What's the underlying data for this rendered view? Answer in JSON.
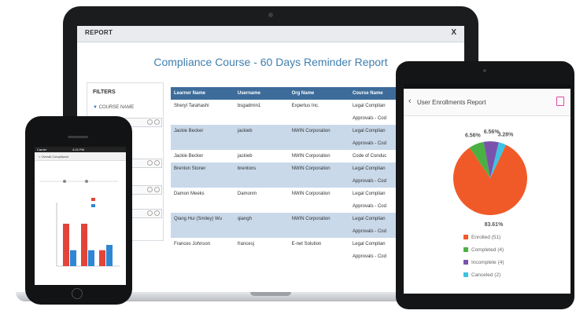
{
  "report": {
    "window_title": "REPORT",
    "close_label": "X",
    "title": "Compliance Course - 60 Days Reminder Report",
    "filters_title": "FILTERS",
    "filter_course_label": "COURSE NAME",
    "columns": [
      "Learner Name",
      "Username",
      "Org Name",
      "Course Name"
    ],
    "rows": [
      [
        "Sheryl Tarahashi",
        "bsgadmin1",
        "Expertus Inc.",
        "Legal Complian"
      ],
      [
        "",
        "",
        "",
        "Approvals - Cod"
      ],
      [
        "Jackie Becker",
        "jackieb",
        "NWIN Corporation",
        "Legal Complian"
      ],
      [
        "",
        "",
        "",
        "Approvals - Cod"
      ],
      [
        "Jackie Becker",
        "jackieb",
        "NWIN Corporation",
        "Code of Conduc"
      ],
      [
        "Brenton Stoner",
        "brentons",
        "NWIN Corporation",
        "Legal Complian"
      ],
      [
        "",
        "",
        "",
        "Approvals - Cod"
      ],
      [
        "Damon Meeks",
        "Damonm",
        "NWIN Corporation",
        "Legal Complian"
      ],
      [
        "",
        "",
        "",
        "Approvals - Cod"
      ],
      [
        "Qiang Hui (Smiley) Wu",
        "qiangh",
        "NWIN Corporation",
        "Legal Complian"
      ],
      [
        "",
        "",
        "",
        "Approvals - Cod"
      ],
      [
        "Frances Johnson",
        "francesj",
        "E-net Solution",
        "Legal Complian"
      ],
      [
        "",
        "",
        "",
        "Approvals - Cod"
      ]
    ]
  },
  "phone": {
    "status_carrier": "Carrier",
    "status_time": "4:24 PM",
    "nav_title": "< Overall Compliance",
    "chart_data": {
      "type": "bar",
      "categories": [
        "",
        "",
        ""
      ],
      "series": [
        {
          "name": "",
          "values": [
            4,
            4,
            1.5
          ],
          "color": "#e2443a"
        },
        {
          "name": "",
          "values": [
            1.5,
            1.5,
            2
          ],
          "color": "#2f86d3"
        }
      ],
      "ylim": [
        0,
        6
      ]
    }
  },
  "tablet": {
    "title": "User Enrollments Report",
    "chart_data": {
      "type": "pie",
      "slices": [
        {
          "label": "Enrolled (51)",
          "value": 83.61,
          "pct_label": "83.61%",
          "color": "#f05a28"
        },
        {
          "label": "Completed (4)",
          "value": 6.56,
          "pct_label": "6.56%",
          "color": "#4bb043"
        },
        {
          "label": "Incomplete (4)",
          "value": 6.56,
          "pct_label": "6.56%",
          "color": "#7b52ab"
        },
        {
          "label": "Canceled (2)",
          "value": 3.28,
          "pct_label": "3.28%",
          "color": "#3ec3e2"
        }
      ]
    }
  }
}
